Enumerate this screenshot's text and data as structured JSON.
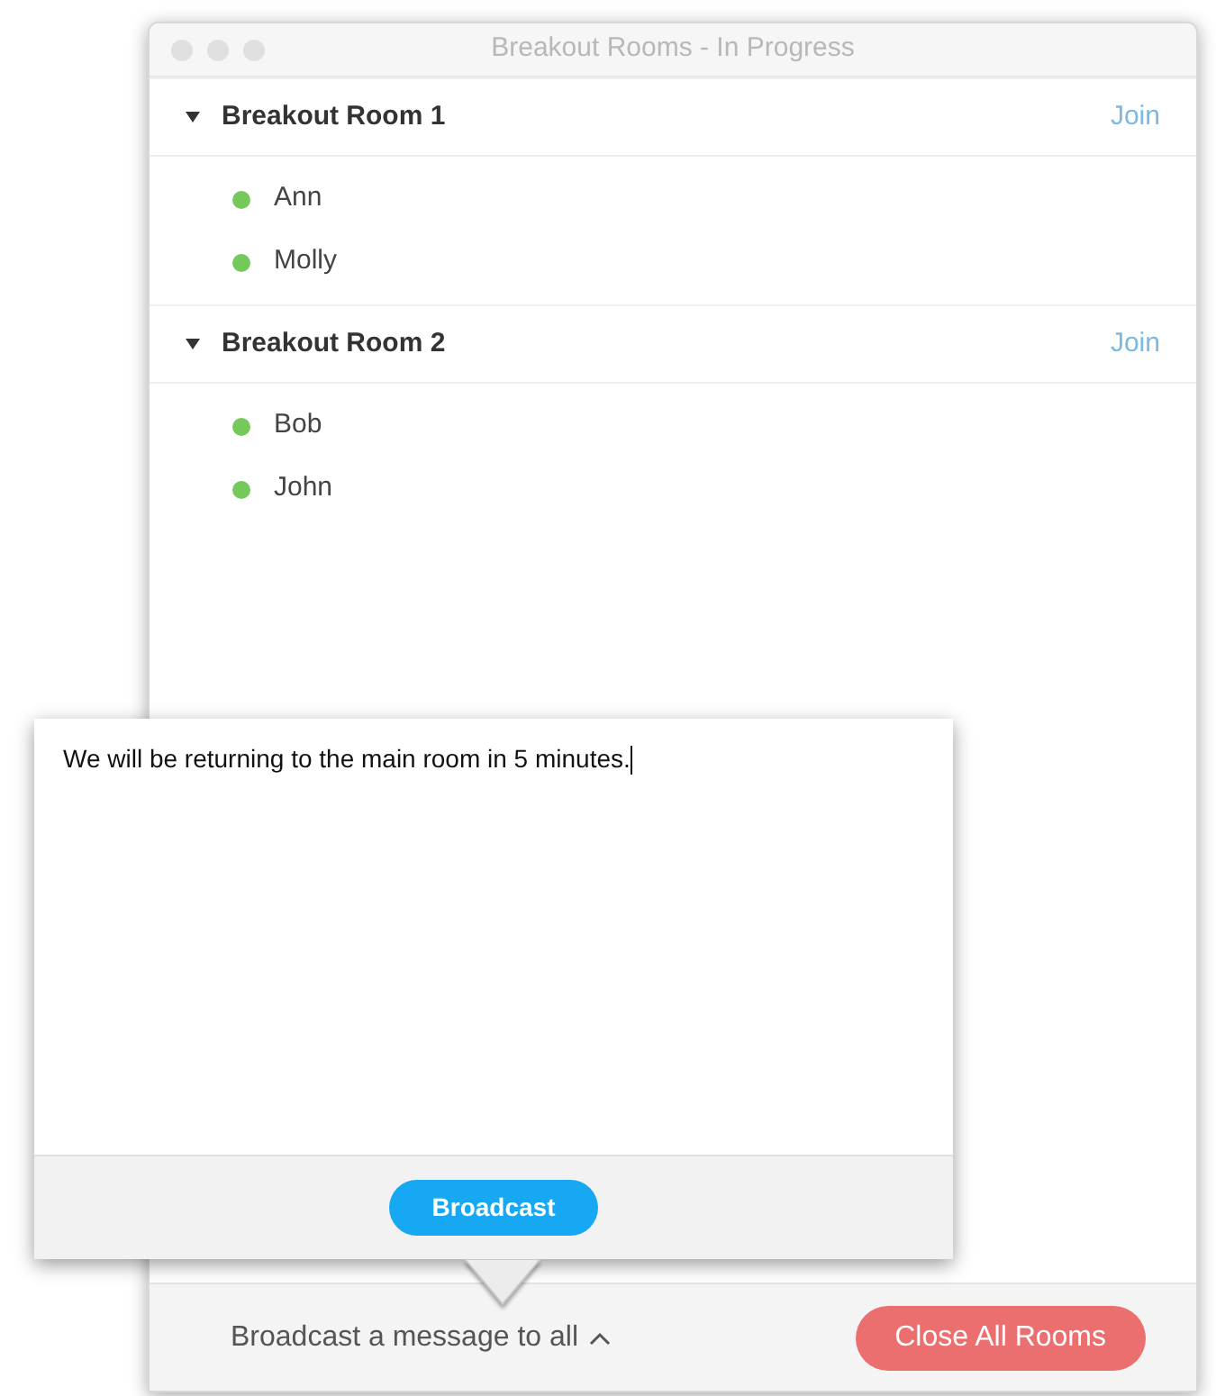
{
  "window": {
    "title": "Breakout Rooms - In Progress"
  },
  "rooms": [
    {
      "name": "Breakout Room 1",
      "expanded": true,
      "join": "Join",
      "members": [
        {
          "name": "Ann",
          "color": "#74c95a"
        },
        {
          "name": "Molly",
          "color": "#74c95a"
        }
      ]
    },
    {
      "name": "Breakout Room 2",
      "expanded": true,
      "join": "Join",
      "members": [
        {
          "name": "Bob",
          "color": "#74c95a"
        },
        {
          "name": "John",
          "color": "#74c95a"
        }
      ]
    }
  ],
  "broadcast_popup": {
    "message": "We will be returning to the main room in 5 minutes.",
    "button": "Broadcast"
  },
  "footer": {
    "broadcast_toggle": "Broadcast a message to all",
    "close_button": "Close All Rooms"
  }
}
